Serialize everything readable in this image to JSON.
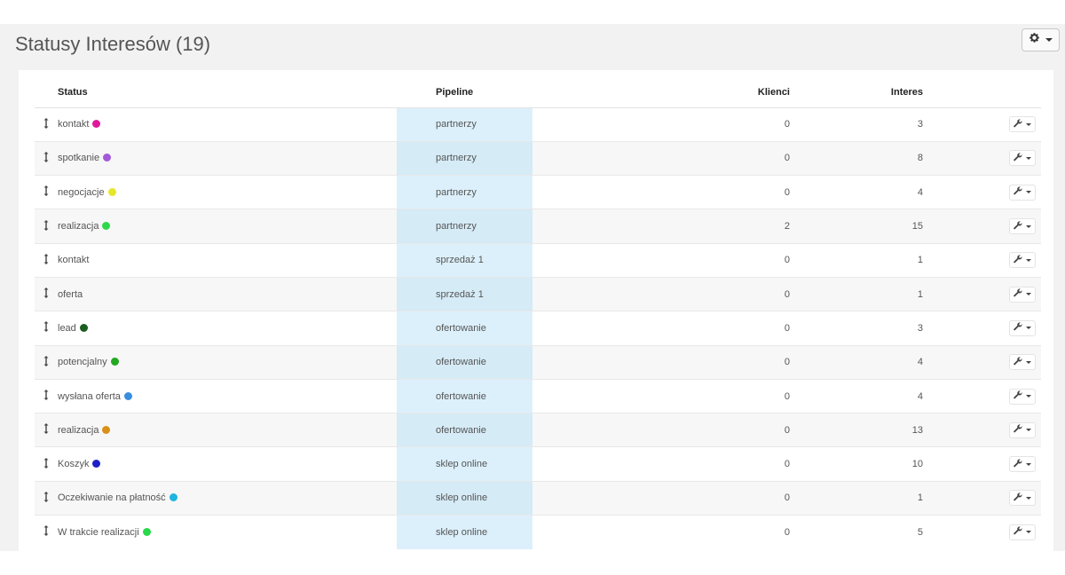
{
  "page": {
    "title": "Statusy Interesów (19)",
    "settings_icon": "gear-icon"
  },
  "table": {
    "headers": {
      "status": "Status",
      "pipeline": "Pipeline",
      "klienci": "Klienci",
      "interes": "Interes"
    },
    "rows": [
      {
        "status": "kontakt",
        "dot": "#e0199a",
        "pipeline": "partnerzy",
        "klienci": "0",
        "interes": "3"
      },
      {
        "status": "spotkanie",
        "dot": "#a35ad8",
        "pipeline": "partnerzy",
        "klienci": "0",
        "interes": "8"
      },
      {
        "status": "negocjacje",
        "dot": "#e6e62a",
        "pipeline": "partnerzy",
        "klienci": "0",
        "interes": "4"
      },
      {
        "status": "realizacja",
        "dot": "#2dd84a",
        "pipeline": "partnerzy",
        "klienci": "2",
        "interes": "15"
      },
      {
        "status": "kontakt",
        "dot": null,
        "pipeline": "sprzedaż 1",
        "klienci": "0",
        "interes": "1"
      },
      {
        "status": "oferta",
        "dot": null,
        "pipeline": "sprzedaż 1",
        "klienci": "0",
        "interes": "1"
      },
      {
        "status": "lead",
        "dot": "#1b5e20",
        "pipeline": "ofertowanie",
        "klienci": "0",
        "interes": "3"
      },
      {
        "status": "potencjalny",
        "dot": "#22a822",
        "pipeline": "ofertowanie",
        "klienci": "0",
        "interes": "4"
      },
      {
        "status": "wysłana oferta",
        "dot": "#3a8ee0",
        "pipeline": "ofertowanie",
        "klienci": "0",
        "interes": "4"
      },
      {
        "status": "realizacja",
        "dot": "#d99018",
        "pipeline": "ofertowanie",
        "klienci": "0",
        "interes": "13"
      },
      {
        "status": "Koszyk",
        "dot": "#2020c8",
        "pipeline": "sklep online",
        "klienci": "0",
        "interes": "10"
      },
      {
        "status": "Oczekiwanie na płatność",
        "dot": "#1cb6e0",
        "pipeline": "sklep online",
        "klienci": "0",
        "interes": "1"
      },
      {
        "status": "W trakcie realizacji",
        "dot": "#28d84a",
        "pipeline": "sklep online",
        "klienci": "0",
        "interes": "5"
      }
    ],
    "row_handle_icon": "drag-handle-icon",
    "row_action_icon": "wrench-icon"
  }
}
